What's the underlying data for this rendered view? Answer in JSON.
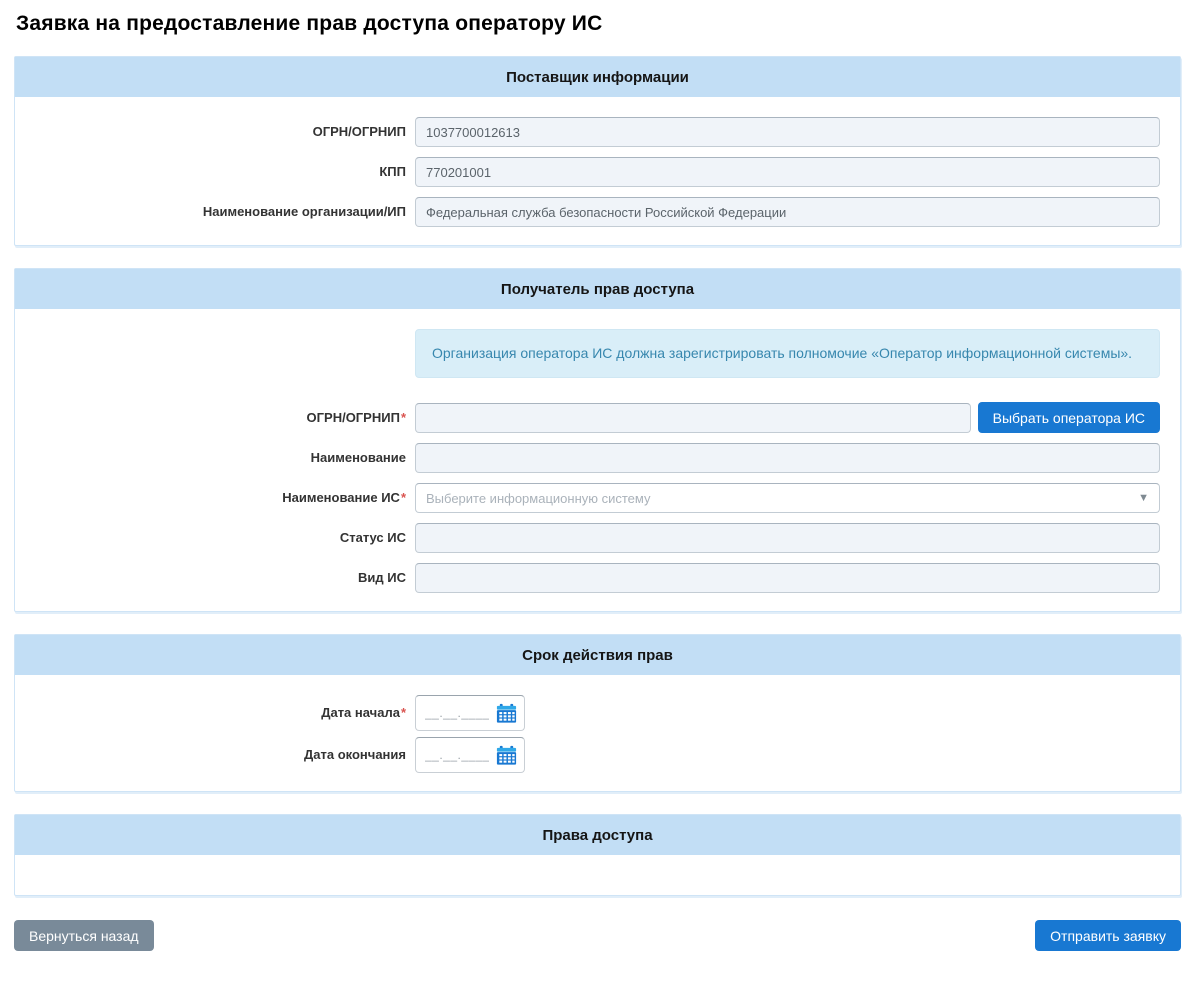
{
  "page": {
    "title": "Заявка на предоставление прав доступа оператору ИС"
  },
  "common": {
    "required_mark": "*"
  },
  "provider": {
    "title": "Поставщик информации",
    "ogrn_label": "ОГРН/ОГРНИП",
    "ogrn_value": "1037700012613",
    "kpp_label": "КПП",
    "kpp_value": "770201001",
    "org_label": "Наименование организации/ИП",
    "org_value": "Федеральная служба безопасности Российской Федерации"
  },
  "recipient": {
    "title": "Получатель прав доступа",
    "info_message": "Организация оператора ИС должна зарегистрировать полномочие «Оператор информационной системы».",
    "ogrn_label": "ОГРН/ОГРНИП",
    "select_operator_button": "Выбрать оператора ИС",
    "name_label": "Наименование",
    "is_name_label": "Наименование ИС",
    "is_name_placeholder": "Выберите информационную систему",
    "is_status_label": "Статус ИС",
    "is_kind_label": "Вид ИС"
  },
  "validity": {
    "title": "Срок действия прав",
    "start_label": "Дата начала",
    "end_label": "Дата окончания",
    "date_mask": "__.__.____"
  },
  "rights": {
    "title": "Права доступа"
  },
  "footer": {
    "back_button": "Вернуться назад",
    "submit_button": "Отправить заявку"
  },
  "icons": {
    "calendar": "calendar-icon",
    "dropdown_caret": "chevron-down-icon"
  },
  "colors": {
    "section_header_bg": "#c2def5",
    "panel_border": "#cfe4f6",
    "input_bg": "#f0f4f9",
    "info_bg": "#d9eef8",
    "info_text": "#3787ae",
    "primary_button": "#1878d2",
    "secondary_button": "#798a99",
    "required_mark": "#d9534f"
  }
}
